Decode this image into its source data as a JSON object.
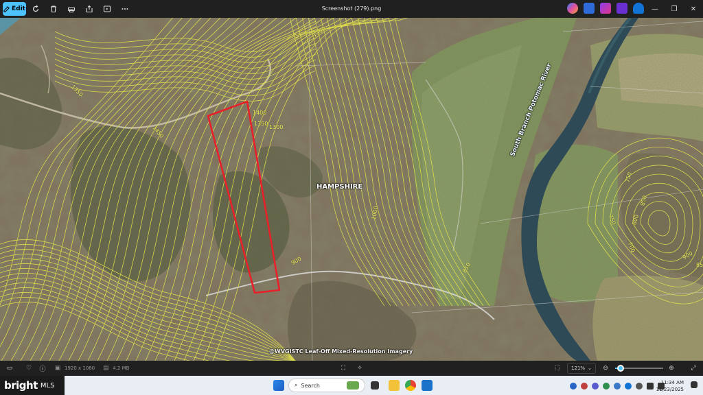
{
  "window": {
    "title": "Screenshot (279).png",
    "edit_label": "Edit"
  },
  "toolbar_icons": [
    "rotate-icon",
    "delete-icon",
    "print-icon",
    "share-icon",
    "slideshow-icon",
    "more-icon"
  ],
  "app_icons": [
    "copilot-icon",
    "clipchamp-icon",
    "designer-icon",
    "studio-icon",
    "onedrive-icon"
  ],
  "map": {
    "county_label": "HAMPSHIRE",
    "river_label": "South Branch Potomac River",
    "credit": "@WVGISTC Leaf-Off Mixed-Resolution Imagery",
    "contours": [
      "1350",
      "1350",
      "1450",
      "1400",
      "1350",
      "1300",
      "1000",
      "900",
      "850",
      "750",
      "850",
      "800",
      "750",
      "700",
      "900",
      "85"
    ],
    "boundary_color": "#e8202a",
    "contour_color": "#e4e44a"
  },
  "bottom_bar": {
    "dimensions": "1920 x 1080",
    "file_size": "4.2 MB",
    "zoom": "121%",
    "zoom_fraction": 0.12
  },
  "brand": {
    "name": "bright",
    "suffix": "MLS"
  },
  "taskbar": {
    "search_placeholder": "Search"
  },
  "clock": {
    "time": "11:34 AM",
    "date": "11/23/2025"
  }
}
